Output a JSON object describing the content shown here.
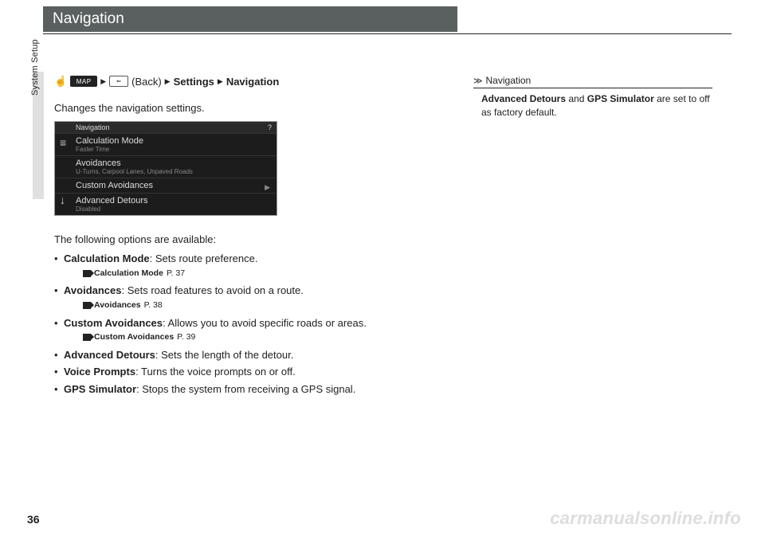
{
  "header": {
    "title": "Navigation"
  },
  "side_label": "System Setup",
  "breadcrumb": {
    "map_label": "MAP",
    "back_text": "(Back)",
    "settings": "Settings",
    "navigation": "Navigation"
  },
  "intro": "Changes the navigation settings.",
  "screenshot": {
    "title": "Navigation",
    "help": "?",
    "rows": [
      {
        "label": "Calculation Mode",
        "sub": "Faster Time"
      },
      {
        "label": "Avoidances",
        "sub": "U-Turns, Carpool Lanes, Unpaved Roads"
      },
      {
        "label": "Custom Avoidances",
        "sub": ""
      },
      {
        "label": "Advanced Detours",
        "sub": "Disabled"
      }
    ]
  },
  "options_intro": "The following options are available:",
  "options": [
    {
      "title": "Calculation Mode",
      "desc": ": Sets route preference.",
      "ref": "Calculation Mode",
      "page": "P. 37"
    },
    {
      "title": "Avoidances",
      "desc": ": Sets road features to avoid on a route.",
      "ref": "Avoidances",
      "page": "P. 38"
    },
    {
      "title": "Custom Avoidances",
      "desc": ": Allows you to avoid specific roads or areas.",
      "ref": "Custom Avoidances",
      "page": "P. 39"
    },
    {
      "title": "Advanced Detours",
      "desc": ": Sets the length of the detour."
    },
    {
      "title": "Voice Prompts",
      "desc": ": Turns the voice prompts on or off."
    },
    {
      "title": "GPS Simulator",
      "desc": ": Stops the system from receiving a GPS signal."
    }
  ],
  "sidebar": {
    "head": "Navigation",
    "body_b1": "Advanced Detours",
    "body_mid": " and ",
    "body_b2": "GPS Simulator",
    "body_tail": " are set to off as factory default."
  },
  "page_number": "36",
  "watermark": "carmanualsonline.info"
}
